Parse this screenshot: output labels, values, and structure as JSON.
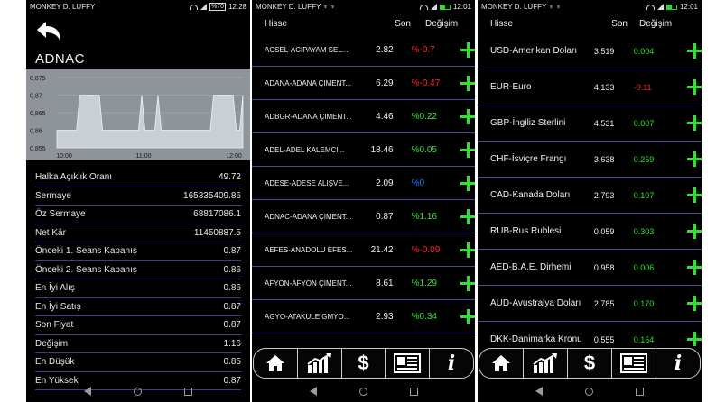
{
  "screens": [
    {
      "status": {
        "carrier": "MONKEY D. LUFFY",
        "battery": "%70",
        "time": "12:28"
      },
      "title": "ADNAC",
      "chart_data": {
        "type": "area",
        "y_ticks": [
          "0,875",
          "0,87",
          "0,865",
          "0,86",
          "0,855"
        ],
        "x_ticks": [
          "10:00",
          "11:00",
          "12:00"
        ],
        "ylim": [
          0.855,
          0.875
        ],
        "values": [
          0.86,
          0.86,
          0.86,
          0.86,
          0.86,
          0.86,
          0.86,
          0.87,
          0.87,
          0.87,
          0.87,
          0.87,
          0.87,
          0.87,
          0.86,
          0.86,
          0.86,
          0.86,
          0.86,
          0.86,
          0.86,
          0.86,
          0.86,
          0.86,
          0.86,
          0.86,
          0.87,
          0.86,
          0.86,
          0.86,
          0.86,
          0.87,
          0.86,
          0.86,
          0.86,
          0.86,
          0.86,
          0.86,
          0.86,
          0.86,
          0.86,
          0.86,
          0.86,
          0.86,
          0.86,
          0.86,
          0.86,
          0.86,
          0.87,
          0.87,
          0.87,
          0.87,
          0.87,
          0.87,
          0.87,
          0.86,
          0.86,
          0.87
        ],
        "grid": true
      },
      "details": [
        {
          "label": "Halka Açıklık Oranı",
          "value": "49.72"
        },
        {
          "label": "Sermaye",
          "value": "165335409.86"
        },
        {
          "label": "Öz Sermaye",
          "value": "68817086.1"
        },
        {
          "label": "Net Kâr",
          "value": "11450887.5"
        },
        {
          "label": "Önceki 1. Seans Kapanış",
          "value": "0.87"
        },
        {
          "label": "Önceki 2. Seans Kapanış",
          "value": "0.86"
        },
        {
          "label": "En İyi Alış",
          "value": "0.86"
        },
        {
          "label": "En İyi Satış",
          "value": "0.87"
        },
        {
          "label": "Son Fiyat",
          "value": "0.87"
        },
        {
          "label": "Değişim",
          "value": "1.16"
        },
        {
          "label": "En Düşük",
          "value": "0.85"
        },
        {
          "label": "En Yüksek",
          "value": "0.87"
        }
      ]
    },
    {
      "status": {
        "carrier": "MONKEY D. LUFFY",
        "time": "12:01"
      },
      "headers": {
        "name": "Hisse",
        "last": "Son",
        "change": "Değişim"
      },
      "rows": [
        {
          "name": "ACSEL-ACIPAYAM SEL...",
          "last": "2.82",
          "change": "%-0.7",
          "dir": "down"
        },
        {
          "name": "ADANA-ADANA ÇIMENT...",
          "last": "6.29",
          "change": "%-0.47",
          "dir": "down"
        },
        {
          "name": "ADBGR-ADANA ÇIMENT...",
          "last": "4.46",
          "change": "%0.22",
          "dir": "up"
        },
        {
          "name": "ADEL-ADEL KALEMCI...",
          "last": "18.46",
          "change": "%0.05",
          "dir": "up"
        },
        {
          "name": "ADESE-ADESE ALIŞVE...",
          "last": "2.09",
          "change": "%0",
          "dir": "flat"
        },
        {
          "name": "ADNAC-ADANA ÇIMENT...",
          "last": "0.87",
          "change": "%1.16",
          "dir": "up"
        },
        {
          "name": "AEFES-ANADOLU EFES...",
          "last": "21.42",
          "change": "%-0.09",
          "dir": "down"
        },
        {
          "name": "AFYON-AFYON ÇIMENT...",
          "last": "8.61",
          "change": "%1.29",
          "dir": "up"
        },
        {
          "name": "AGYO-ATAKULE GMYO...",
          "last": "2.93",
          "change": "%0.34",
          "dir": "up"
        }
      ]
    },
    {
      "status": {
        "carrier": "MONKEY D. LUFFY",
        "time": "12:01"
      },
      "headers": {
        "name": "Hisse",
        "last": "Son",
        "change": "Değişim"
      },
      "rows": [
        {
          "name": "USD-Amerikan Doları",
          "last": "3.519",
          "change": "0.004",
          "dir": "up"
        },
        {
          "name": "EUR-Euro",
          "last": "4.133",
          "change": "-0.11",
          "dir": "down"
        },
        {
          "name": "GBP-İngiliz Sterlini",
          "last": "4.531",
          "change": "0.007",
          "dir": "up"
        },
        {
          "name": "CHF-İsviçre Frangı",
          "last": "3.638",
          "change": "0.259",
          "dir": "up"
        },
        {
          "name": "CAD-Kanada Doları",
          "last": "2.793",
          "change": "0.107",
          "dir": "up"
        },
        {
          "name": "RUB-Rus Rublesi",
          "last": "0.059",
          "change": "0.303",
          "dir": "up"
        },
        {
          "name": "AED-B.A.E. Dirhemi",
          "last": "0.958",
          "change": "0.006",
          "dir": "up"
        },
        {
          "name": "AUD-Avustralya Doları",
          "last": "2.785",
          "change": "0.170",
          "dir": "up"
        },
        {
          "name": "DKK-Danimarka Kronu",
          "last": "0.555",
          "change": "0.154",
          "dir": "up"
        }
      ]
    }
  ],
  "tabs": [
    {
      "icon": "home-icon"
    },
    {
      "icon": "chart-icon"
    },
    {
      "icon": "dollar-icon",
      "label": "$"
    },
    {
      "icon": "news-icon"
    },
    {
      "icon": "info-icon",
      "label": "i"
    }
  ],
  "colors": {
    "up": "#2fe32f",
    "down": "#ff2626",
    "flat": "#1f7bff",
    "divider": "#444a9a",
    "chart_bg": "#8e9499",
    "chart_fill": "#c9cfd4"
  }
}
